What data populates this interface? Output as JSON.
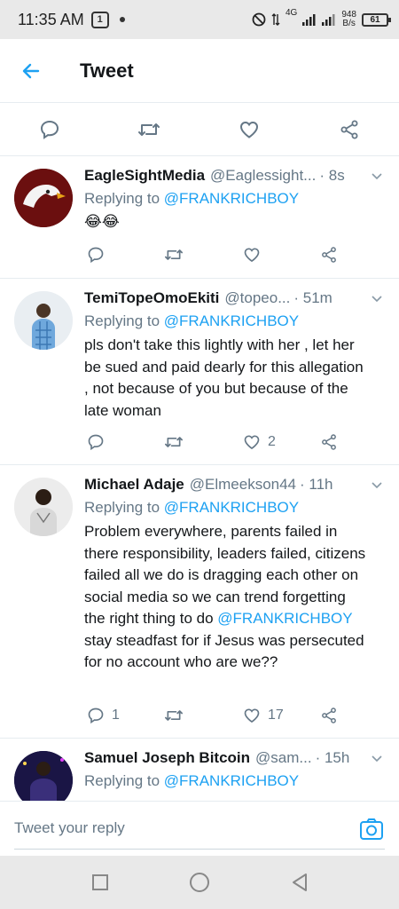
{
  "status_bar": {
    "time": "11:35 AM",
    "badge": "1",
    "network_type": "4G",
    "speed_value": "948",
    "speed_unit": "B/s",
    "battery": "61"
  },
  "header": {
    "title": "Tweet",
    "back_icon": "arrow-left-icon",
    "accent_color": "#1da1f2"
  },
  "main_actions": [
    "reply-icon",
    "retweet-icon",
    "like-icon",
    "share-icon"
  ],
  "replies": [
    {
      "name": "EagleSightMedia",
      "handle": "@Eaglessight...",
      "time": "· 8s",
      "replying_prefix": "Replying to ",
      "replying_to": "@FRANKRICHBOY",
      "text": "😂😂",
      "reply_count": "",
      "like_count": ""
    },
    {
      "name": "TemiTopeOmoEkiti",
      "handle": "@topeo...",
      "time": "· 51m",
      "replying_prefix": "Replying to ",
      "replying_to": "@FRANKRICHBOY",
      "text": "pls don't take this lightly with her , let her be sued and paid dearly for this allegation , not because of you but because of the late woman",
      "reply_count": "",
      "like_count": "2"
    },
    {
      "name": "Michael Adaje",
      "handle": "@Elmeekson44",
      "time": "· 11h",
      "replying_prefix": "Replying to ",
      "replying_to": "@FRANKRICHBOY",
      "text": "Problem everywhere, parents failed in there responsibility, leaders failed, citizens failed all we do is dragging each other on social media so we can trend forgetting the right thing to do ",
      "text_mention": "@FRANKRICHBOY",
      "text_after": "  stay steadfast for if Jesus was persecuted for no account who are we??",
      "reply_count": "1",
      "like_count": "17"
    },
    {
      "name": "Samuel Joseph Bitcoin",
      "handle": "@sam...",
      "time": "· 15h",
      "replying_prefix": "Replying to ",
      "replying_to": "@FRANKRICHBOY"
    }
  ],
  "composer": {
    "placeholder": "Tweet your reply",
    "camera_icon": "camera-icon"
  },
  "navigation": [
    "recents-square-icon",
    "home-circle-icon",
    "back-triangle-icon"
  ]
}
